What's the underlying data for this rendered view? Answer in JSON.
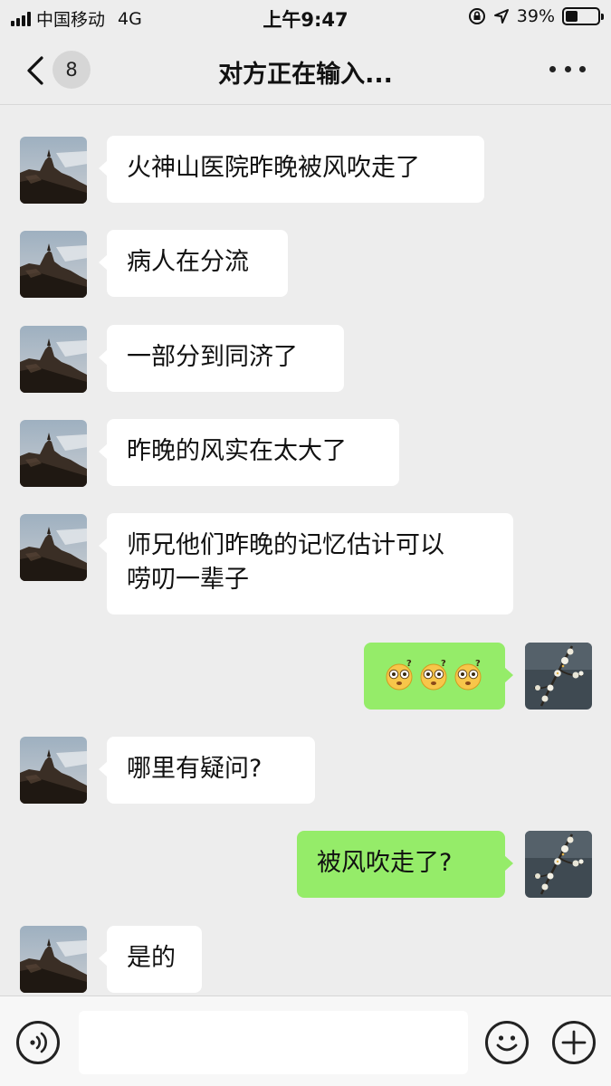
{
  "status_bar": {
    "carrier": "中国移动",
    "network": "4G",
    "time": "上午9:47",
    "battery_percent": "39%",
    "battery_level": 0.39
  },
  "nav": {
    "back_icon": "chevron-left-icon",
    "unread_count": "8",
    "title": "对方正在输入...",
    "more_icon": "more-dots-icon"
  },
  "messages": [
    {
      "from": "other",
      "text": "火神山医院昨晚被风吹走了"
    },
    {
      "from": "other",
      "text": "病人在分流"
    },
    {
      "from": "other",
      "text": "一部分到同济了"
    },
    {
      "from": "other",
      "text": "昨晚的风实在太大了"
    },
    {
      "from": "other",
      "text": "师兄他们昨晚的记忆估计可以\n唠叨一辈子"
    },
    {
      "from": "me",
      "text": "",
      "emoji": [
        "confused-face-emoji",
        "confused-face-emoji",
        "confused-face-emoji"
      ]
    },
    {
      "from": "other",
      "text": "哪里有疑问?"
    },
    {
      "from": "me",
      "text": "被风吹走了?"
    },
    {
      "from": "other",
      "text": "是的"
    }
  ],
  "input_bar": {
    "voice_icon": "voice-icon",
    "emoji_icon": "smiley-icon",
    "plus_icon": "plus-icon",
    "input_value": ""
  },
  "colors": {
    "background": "#ededed",
    "incoming_bubble": "#ffffff",
    "outgoing_bubble": "#95ec69",
    "input_bar": "#f7f7f7"
  }
}
